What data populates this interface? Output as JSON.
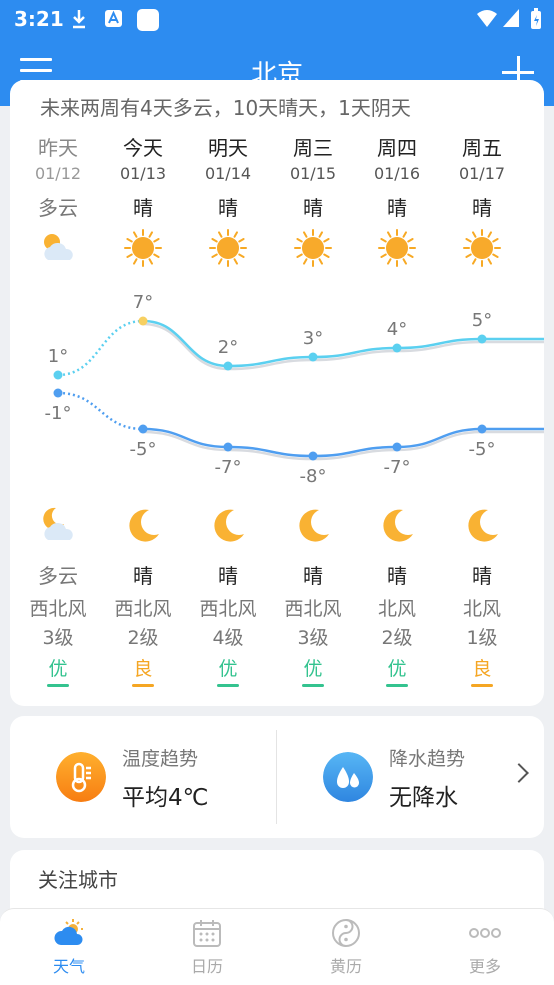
{
  "status": {
    "time": "3:21"
  },
  "header": {
    "city": "北京"
  },
  "forecast": {
    "summary": "未来两周有4天多云，10天晴天，1天阴天",
    "days": [
      {
        "name": "昨天",
        "date": "01/12",
        "day_condition": "多云",
        "day_icon": "partly-cloudy-icon",
        "high": "1°",
        "low": "-1°",
        "night_icon": "partly-cloudy-night-icon",
        "night_condition": "多云",
        "wind_dir": "西北风",
        "wind_level": "3级",
        "aqi": "优",
        "past": true
      },
      {
        "name": "今天",
        "date": "01/13",
        "day_condition": "晴",
        "day_icon": "sun-icon",
        "high": "7°",
        "low": "-5°",
        "night_icon": "moon-icon",
        "night_condition": "晴",
        "wind_dir": "西北风",
        "wind_level": "2级",
        "aqi": "良",
        "past": false
      },
      {
        "name": "明天",
        "date": "01/14",
        "day_condition": "晴",
        "day_icon": "sun-icon",
        "high": "2°",
        "low": "-7°",
        "night_icon": "moon-icon",
        "night_condition": "晴",
        "wind_dir": "西北风",
        "wind_level": "4级",
        "aqi": "优",
        "past": false
      },
      {
        "name": "周三",
        "date": "01/15",
        "day_condition": "晴",
        "day_icon": "sun-icon",
        "high": "3°",
        "low": "-8°",
        "night_icon": "moon-icon",
        "night_condition": "晴",
        "wind_dir": "西北风",
        "wind_level": "3级",
        "aqi": "优",
        "past": false
      },
      {
        "name": "周四",
        "date": "01/16",
        "day_condition": "晴",
        "day_icon": "sun-icon",
        "high": "4°",
        "low": "-7°",
        "night_icon": "moon-icon",
        "night_condition": "晴",
        "wind_dir": "北风",
        "wind_level": "2级",
        "aqi": "优",
        "past": false
      },
      {
        "name": "周五",
        "date": "01/17",
        "day_condition": "晴",
        "day_icon": "sun-icon",
        "high": "5°",
        "low": "-5°",
        "night_icon": "moon-icon",
        "night_condition": "晴",
        "wind_dir": "北风",
        "wind_level": "1级",
        "aqi": "良",
        "past": false
      }
    ]
  },
  "chart_data": {
    "type": "line",
    "categories": [
      "01/12",
      "01/13",
      "01/14",
      "01/15",
      "01/16",
      "01/17"
    ],
    "series": [
      {
        "values": [
          1,
          7,
          2,
          3,
          4,
          5
        ],
        "color": "#5bd0f0"
      },
      {
        "values": [
          -1,
          -5,
          -7,
          -8,
          -7,
          -5
        ],
        "color": "#4f9ef0"
      }
    ],
    "ylim": [
      -9,
      8
    ],
    "grid": false
  },
  "colors": {
    "good": "#34c38f",
    "fine": "#f5a623",
    "brand": "#2d8cf0"
  },
  "trends": {
    "temperature": {
      "title": "温度趋势",
      "value": "平均4℃",
      "icon": "thermometer-icon"
    },
    "precipitation": {
      "title": "降水趋势",
      "value": "无降水",
      "icon": "raindrops-icon"
    }
  },
  "follow": {
    "title": "关注城市"
  },
  "nav": {
    "items": [
      {
        "label": "天气",
        "icon": "weather-icon"
      },
      {
        "label": "日历",
        "icon": "calendar-icon"
      },
      {
        "label": "黄历",
        "icon": "yinyang-icon"
      },
      {
        "label": "更多",
        "icon": "more-icon"
      }
    ]
  }
}
